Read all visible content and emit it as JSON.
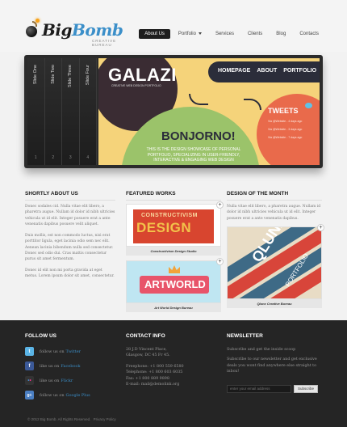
{
  "header": {
    "logo_part1": "Big",
    "logo_part2": "Bomb",
    "tagline": "CREATIVE BUREAU",
    "nav": [
      {
        "label": "About Us",
        "active": true
      },
      {
        "label": "Portfolio",
        "has_dropdown": true
      },
      {
        "label": "Services"
      },
      {
        "label": "Clients"
      },
      {
        "label": "Blog"
      },
      {
        "label": "Contacts"
      }
    ]
  },
  "slider": {
    "tabs": [
      {
        "label": "Slide One",
        "num": "1"
      },
      {
        "label": "Slide Two",
        "num": "2"
      },
      {
        "label": "Slide Three",
        "num": "3"
      },
      {
        "label": "Slide Four",
        "num": "4"
      }
    ],
    "slide": {
      "brand": "GALAZI",
      "brand_sub": "CREATIVE WEB DESIGN PORTFOLIO",
      "menu": [
        "HOMEPAGE",
        "ABOUT",
        "PORTFOLIO"
      ],
      "headline": "BONJORNO!",
      "description": "THIS IS THE DESIGN SHOWCASE OF PERSONAL PORTFOLIO, SPECIALIZING IN USER-FRIENDLY, INTERACTIVE & ENGAGING WEB DESIGN",
      "tweets_title": "TWEETS",
      "tweet_lines": [
        "Via @Website - 4 days ago",
        "Via @Website - 3 days ago",
        "Via @Website - 7 days ago"
      ]
    },
    "colors": {
      "dark": "#3a2c33",
      "yellow": "#f5d37a",
      "green": "#9bc36a",
      "orange": "#e96a4b",
      "navy": "#2b2d3a"
    }
  },
  "about": {
    "title": "SHORTLY ABOUT US",
    "paragraphs": [
      "Donec sodales cid. Nulla vitae elit libero, a pharetra augue. Nullam id dolor id nibh ultricies vehicula ut id elit. Integer posuere erat a ante venenatis dapibus posuere velit aliquet.",
      "Duis mollis, est non commodo luctus, nisi erat porttitor ligula, eget lacinia odio sem nec elit. Aenean lacinia bibendum nulla sed consectetur. Donec sed odio dui. Cras mattis consectetur purus sit amet fermentum.",
      "Donec id elit non mi porta gravida at eget metus. Lorem ipsum dolor sit amet, consectetur."
    ]
  },
  "featured": {
    "title": "FEATURED WORKS",
    "items": [
      {
        "line1": "CONSTRUCTIVISM",
        "line2": "DESIGN",
        "caption": "Constructivism Design Studio"
      },
      {
        "art_text": "ARTWORLD",
        "caption": "Art World Design Bureau"
      }
    ]
  },
  "design_month": {
    "title": "DESIGN OF THE MONTH",
    "text": "Nulla vitae elit libero, a pharetra augue. Nullam id dolor id nibh ultricies vehicula ut id elit. Integer posuere erat a ante venenatis dapibus.",
    "art_title": "QLUNX",
    "art_sub": "PORTFOLIO",
    "caption": "Qlunx Creative Bureau"
  },
  "footer": {
    "follow": {
      "title": "FOLLOW US",
      "items": [
        {
          "pre": "follow us on",
          "link": "Twitter",
          "icon": "twitter-icon",
          "color": "#5ab4e6",
          "glyph": "t"
        },
        {
          "pre": "like us on",
          "link": "Facebook",
          "icon": "facebook-icon",
          "color": "#3b5998",
          "glyph": "f"
        },
        {
          "pre": "like us on",
          "link": "Flickr",
          "icon": "flickr-icon",
          "color": "#333333",
          "glyph": "••"
        },
        {
          "pre": "follow us on",
          "link": "Google Plus",
          "icon": "google-plus-icon",
          "color": "#4a7ec2",
          "glyph": "g+"
        }
      ]
    },
    "contact": {
      "title": "CONTACT INFO",
      "address": [
        "28 J.D Vincent Place,",
        "Glasgow, DC 45 Fr 45."
      ],
      "phone": "Freephone: +1 800 559 6580",
      "telephone": "Telephone: +1 800 603 6035",
      "fax": "Fax: +1 800 889 9898",
      "email": "E-mail: mail@demolink.org"
    },
    "newsletter": {
      "title": "NEWSLETTER",
      "line1": "Subscribe and get the inside scoop",
      "line2": "Subscribe to our newsletter and get exclusive deals you wont find anywhere else straight to inbox!",
      "placeholder": "enter your email address",
      "button": "Subscribe"
    },
    "copyright": "© 2012 Big Bomb. All Rights Reserved.",
    "privacy": "Privacy Policy"
  }
}
